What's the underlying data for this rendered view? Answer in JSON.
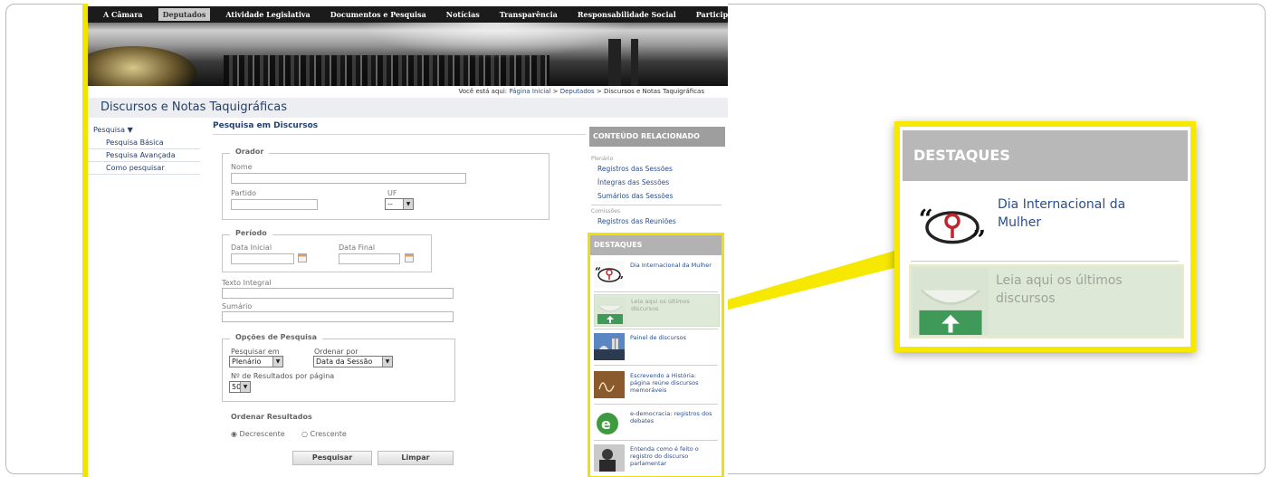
{
  "topnav": {
    "items": [
      "A Câmara",
      "Deputados",
      "Atividade Legislativa",
      "Documentos e Pesquisa",
      "Notícias",
      "Transparência",
      "Responsabilidade Social",
      "Participe"
    ]
  },
  "breadcrumb": {
    "prefix": "Você está aqui:",
    "home": "Página Inicial",
    "sep1": ">",
    "section": "Deputados",
    "sep2": ">",
    "current": "Discursos e Notas Taquigráficas"
  },
  "page_title": "Discursos e Notas Taquigráficas",
  "leftnav": {
    "head": "Pesquisa ▼",
    "items": [
      "Pesquisa Básica",
      "Pesquisa Avançada",
      "Como pesquisar"
    ]
  },
  "form": {
    "title": "Pesquisa em Discursos",
    "orador": {
      "legend": "Orador",
      "nome": "Nome",
      "partido": "Partido",
      "uf": "UF",
      "uf_value": "--"
    },
    "periodo": {
      "legend": "Período",
      "data_inicial": "Data Inicial",
      "data_final": "Data Final"
    },
    "texto_integral": "Texto Integral",
    "sumario": "Sumário",
    "opcoes": {
      "legend": "Opções de Pesquisa",
      "pesquisar_em": "Pesquisar em",
      "pesquisar_em_value": "Plenário",
      "ordenar_por": "Ordenar por",
      "ordenar_por_value": "Data da Sessão",
      "resultados": "Nº de Resultados por página",
      "resultados_value": "50"
    },
    "ordenar_resultados": {
      "title": "Ordenar Resultados",
      "desc": "Decrescente",
      "asc": "Crescente",
      "selected": "Decrescente"
    },
    "buttons": {
      "search": "Pesquisar",
      "clear": "Limpar"
    }
  },
  "related": {
    "head": "CONTEÚDO RELACIONADO",
    "plenario_label": "Plenário",
    "plenario_links": [
      "Registros das Sessões",
      "Íntegras das Sessões",
      "Sumários das Sessões"
    ],
    "comissoes_label": "Comissões",
    "comissoes_links": [
      "Registros das Reuniões"
    ]
  },
  "destaques": {
    "head": "DESTAQUES",
    "items": [
      "Dia Internacional da Mulher",
      "Leia aqui os últimos discursos",
      "Painel de discursos",
      "Escrevendo a História: página reúne discursos memoráveis",
      "e-democracia: registros dos debates",
      "Entenda como é feito o registro do discurso parlamentar"
    ]
  },
  "zoom": {
    "head": "DESTAQUES",
    "item1_line1": "Dia Internacional da",
    "item1_line2": "Mulher",
    "item2_line1": "Leia aqui os últimos",
    "item2_line2": "discursos"
  },
  "colors": {
    "accent_yellow": "#f3e600",
    "link_blue": "#2a4d8c",
    "nav_black": "#1b1b1b",
    "header_gray": "#b2b2b2"
  }
}
